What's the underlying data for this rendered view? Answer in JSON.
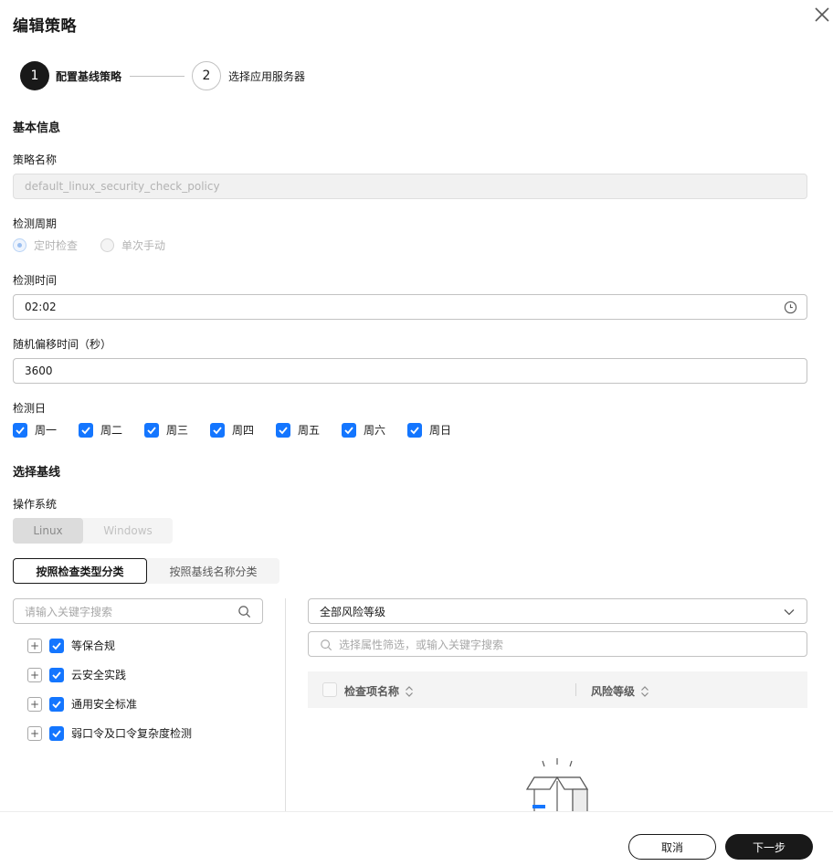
{
  "dialog": {
    "title": "编辑策略"
  },
  "steps": [
    {
      "number": "1",
      "label": "配置基线策略",
      "state": "active"
    },
    {
      "number": "2",
      "label": "选择应用服务器",
      "state": "pending"
    }
  ],
  "basic_info": {
    "section_title": "基本信息",
    "policy_name_label": "策略名称",
    "policy_name_value": "default_linux_security_check_policy",
    "check_cycle_label": "检测周期",
    "cycle_options": [
      {
        "label": "定时检查",
        "checked": true
      },
      {
        "label": "单次手动",
        "checked": false
      }
    ],
    "check_time_label": "检测时间",
    "check_time_value": "02:02",
    "random_offset_label": "随机偏移时间（秒）",
    "random_offset_value": "3600",
    "check_days_label": "检测日",
    "days": [
      "周一",
      "周二",
      "周三",
      "周四",
      "周五",
      "周六",
      "周日"
    ]
  },
  "baseline": {
    "section_title": "选择基线",
    "os_label": "操作系统",
    "os_options": [
      "Linux",
      "Windows"
    ],
    "os_selected": "Linux",
    "category_tabs": [
      "按照检查类型分类",
      "按照基线名称分类"
    ],
    "category_active": "按照检查类型分类",
    "left_search_placeholder": "请输入关键字搜索",
    "tree_items": [
      "等保合规",
      "云安全实践",
      "通用安全标准",
      "弱口令及口令复杂度检测"
    ],
    "risk_select_value": "全部风险等级",
    "filter_placeholder": "选择属性筛选，或输入关键字搜索",
    "table_columns": [
      "检查项名称",
      "风险等级"
    ]
  },
  "footer": {
    "cancel_label": "取消",
    "next_label": "下一步"
  },
  "colors": {
    "primary": "#191919",
    "checkbox": "#1476ff",
    "border": "#c2c2c2"
  }
}
